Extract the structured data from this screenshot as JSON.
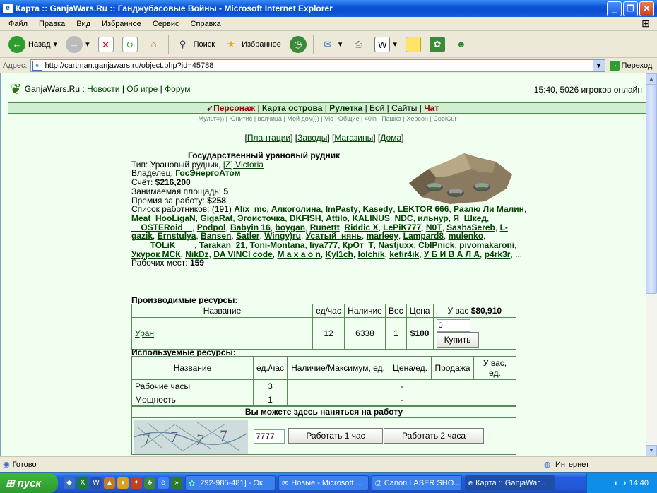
{
  "window": {
    "title": "Карта :: GanjaWars.Ru :: Ганджубасовые Войны - Microsoft Internet Explorer"
  },
  "menu": [
    "Файл",
    "Правка",
    "Вид",
    "Избранное",
    "Сервис",
    "Справка"
  ],
  "toolbar": {
    "back": "Назад",
    "search": "Поиск",
    "favorites": "Избранное"
  },
  "address": {
    "label": "Адрес:",
    "url": "http://cartman.ganjawars.ru/object.php?id=45788",
    "go": "Переход"
  },
  "header": {
    "site": "GanjaWars.Ru :",
    "links": [
      "Новости",
      "Об игре",
      "Форум"
    ],
    "online": "15:40, 5026 игроков онлайн"
  },
  "nav": {
    "items": [
      "Персонаж",
      "Карта острова",
      "Рулетка",
      "Бой",
      "Сайты",
      "Чат"
    ],
    "sub": "Мульт=)) | Юнитис | волчица | Мой дом))) | Vic | Общие | 40in | Пашка | Херсон | CoolCur"
  },
  "objlinks": [
    "Плантации",
    "Заводы",
    "Магазины",
    "Дома"
  ],
  "object": {
    "title": "Государственный урановый рудник",
    "type_label": "Тип: Урановый рудник,",
    "type_link": "[Z] Victoria",
    "owner_label": "Владелец:",
    "owner": "ГосЭнергоАтом",
    "account_label": "Счёт:",
    "account": "$216,200",
    "area_label": "Занимаемая площадь:",
    "area": "5",
    "prize_label": "Премия за работу:",
    "prize": "$258",
    "workers_label": "Список работников: (191)",
    "workers": [
      "Alix_mc",
      "Алкоголина",
      "ImPasty",
      "Kasedy",
      "LEKTOR 666",
      "Разлю Ли Малин",
      "Meat_HooLigaN",
      "GigaRat",
      "Эгоисточка",
      "DKFISH",
      "Attilo",
      "KALINUS",
      "NDC",
      "ильнур",
      "Я_Шкед",
      "__OSTERoid__",
      "Podpol",
      "Babyin 16",
      "boygan",
      "Runettt",
      "Riddic X",
      "LePiK777",
      "N0T",
      "SashaSereb",
      "L-gazik",
      "Ernstulya",
      "Bansen",
      "Satler",
      "Wingy)ru",
      "Усатый_нянь",
      "marleey",
      "Lampard8",
      "mulenko",
      "____TOLiK____",
      "Tarakan_21",
      "Toni-Montana",
      "liya777",
      "КрОт_Т",
      "Nastjuxx",
      "CbIPnick",
      "pivomakaroni",
      "Укурок МСК",
      "NikDz",
      "DA VINCI code",
      "М а х а о n",
      "Kyl1ch",
      "lolchik",
      "kefir4ik",
      "У Б И В А Л А",
      "p4rk3r"
    ],
    "ellipsis": "...",
    "places_label": "Рабочих мест:",
    "places": "159"
  },
  "produced": {
    "title": "Производимые ресурсы:",
    "headers": [
      "Название",
      "ед/час",
      "Наличие",
      "Вес",
      "Цена"
    ],
    "you_have_label": "У вас",
    "you_have": "$80,910",
    "row": {
      "name": "Уран",
      "rate": "12",
      "stock": "6338",
      "weight": "1",
      "price": "$100",
      "qty": "0",
      "buy": "Купить"
    }
  },
  "used": {
    "title": "Используемые ресурсы:",
    "headers": [
      "Название",
      "ед./час",
      "Наличие/Максимум, ед.",
      "Цена/ед.",
      "Продажа",
      "У вас, ед."
    ],
    "rows": [
      {
        "name": "Рабочие часы",
        "rate": "3",
        "dash": "-"
      },
      {
        "name": "Мощность",
        "rate": "1",
        "dash": "-"
      }
    ]
  },
  "job": {
    "title": "Вы можете здесь наняться на работу",
    "code": "7777",
    "btn1": "Работать 1 час",
    "btn2": "Работать 2 часа"
  },
  "status": {
    "text": "Готово",
    "zone": "Интернет"
  },
  "taskbar": {
    "start": "пуск",
    "tasks": [
      "[292-985-481] - Ок...",
      "Новые - Microsoft ...",
      "Canon LASER SHO...",
      "Карта :: GanjaWar..."
    ],
    "clock": "14:40"
  }
}
